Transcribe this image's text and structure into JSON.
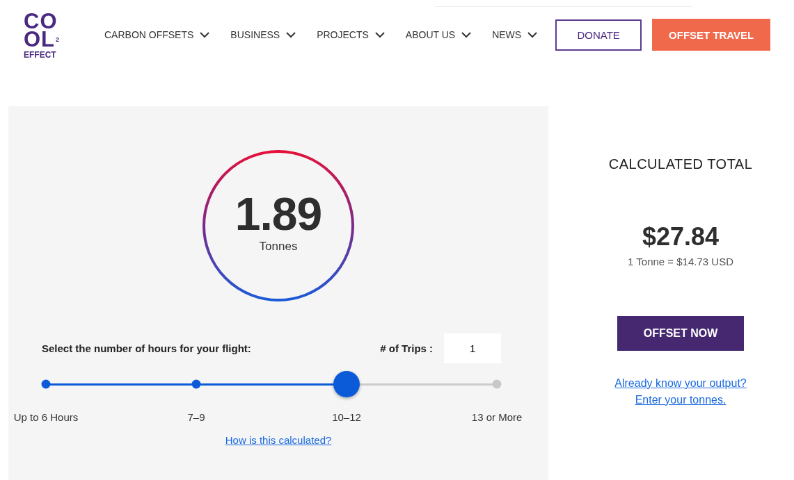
{
  "logo": {
    "top": "CO",
    "bottom": "OL",
    "superscript": "2",
    "word": "EFFECT"
  },
  "nav": [
    {
      "label": "CARBON OFFSETS"
    },
    {
      "label": "BUSINESS"
    },
    {
      "label": "PROJECTS"
    },
    {
      "label": "ABOUT US"
    },
    {
      "label": "NEWS"
    }
  ],
  "donate_button": "DONATE",
  "offset_travel_button": "OFFSET TRAVEL",
  "result": {
    "value": "1.89",
    "unit": "Tonnes"
  },
  "hours_label": "Select the number of hours for your flight:",
  "trips": {
    "label": "# of Trips :",
    "value": "1"
  },
  "hours_slider": {
    "level": 0.6667,
    "steps": [
      {
        "label": "Up to 6 Hours",
        "selected": false
      },
      {
        "label": "7–9",
        "selected": false
      },
      {
        "label": "10–12",
        "selected": true
      },
      {
        "label": "13 or More",
        "selected": false
      }
    ]
  },
  "how_link": "How is this calculated?",
  "total": {
    "title": "CALCULATED TOTAL",
    "amount": "$27.84",
    "rate": "1 Tonne = $14.73 USD",
    "button": "OFFSET NOW",
    "link_line_1": "Already know your output?",
    "link_line_2": "Enter your tonnes."
  }
}
